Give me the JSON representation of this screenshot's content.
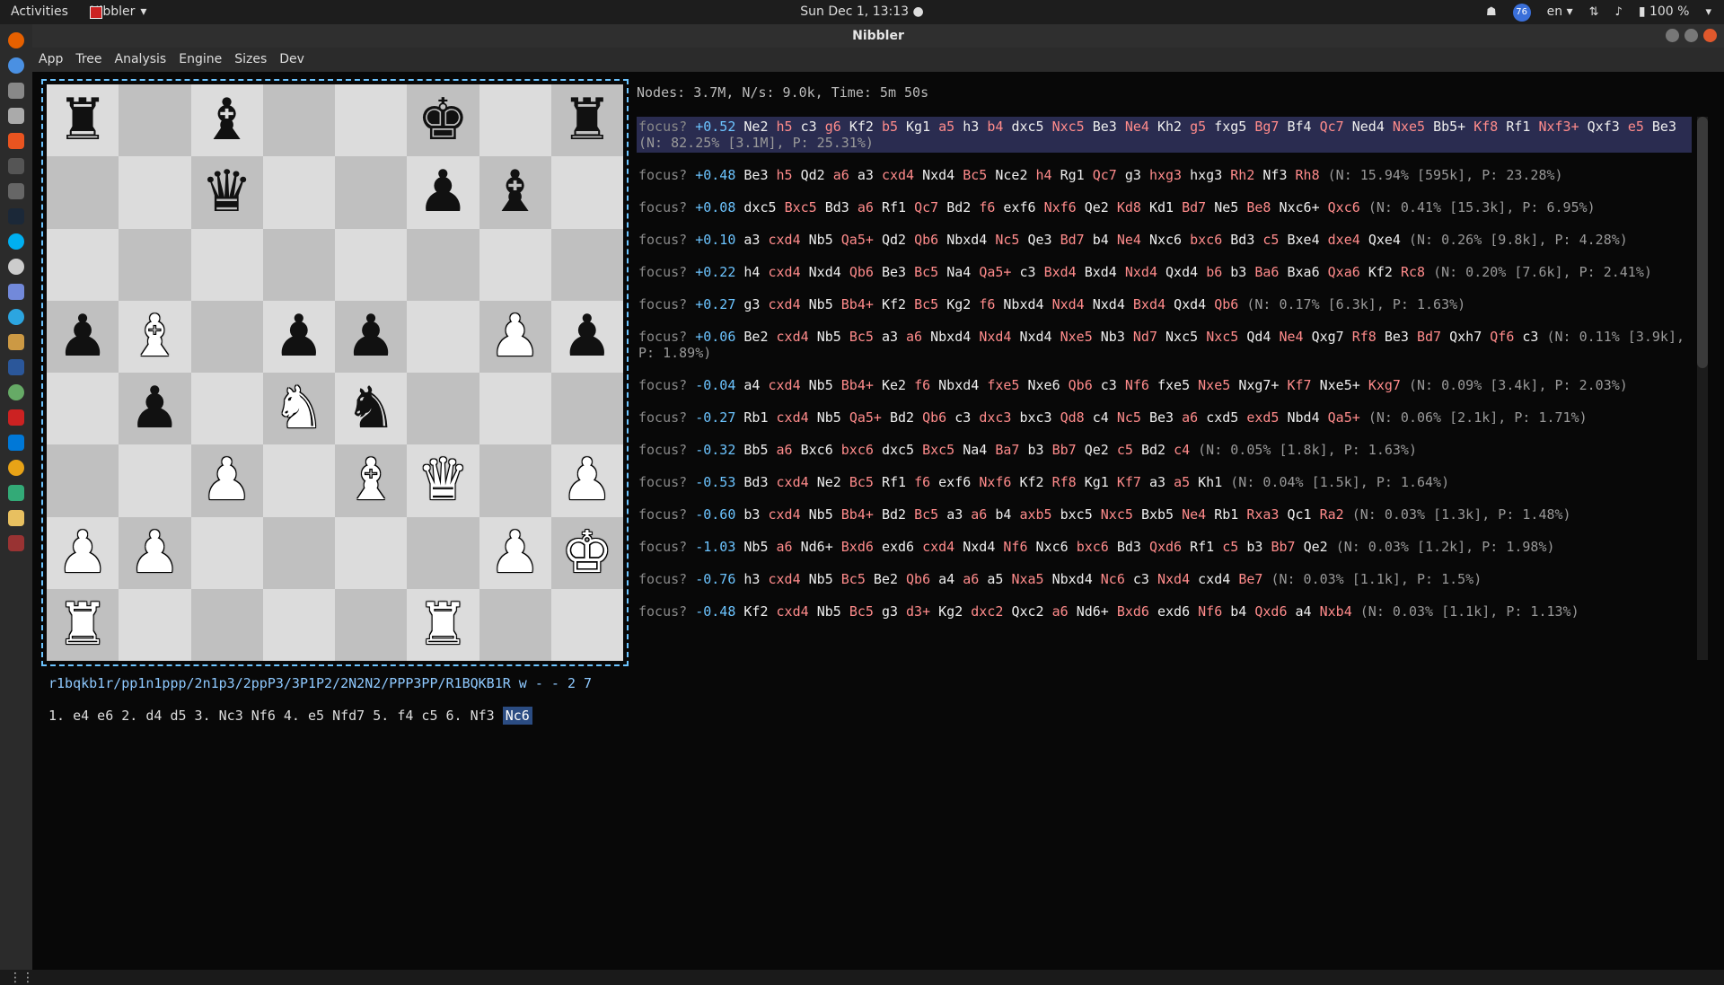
{
  "topbar": {
    "activities": "Activities",
    "app": "Nibbler",
    "clock": "Sun Dec  1, 13:13",
    "badge": "76",
    "lang": "en",
    "battery": "100 %"
  },
  "window": {
    "title": "Nibbler"
  },
  "menu": [
    "App",
    "Tree",
    "Analysis",
    "Engine",
    "Sizes",
    "Dev"
  ],
  "fen": "r1bqkb1r/pp1n1ppp/2n1p3/2ppP3/3P1P2/2N2N2/PPP3PP/R1BQKB1R w - - 2 7",
  "moves": {
    "text": "1. e4 e6 2. d4 d5 3. Nc3 Nf6 4. e5 Nfd7 5. f4 c5 6. Nf3",
    "current": "Nc6"
  },
  "stats": "Nodes: 3.7M, N/s: 9.0k, Time: 5m 50s",
  "focus_word": "focus?",
  "lines": [
    {
      "score": "+0.52",
      "moves": [
        "Ne2",
        "h5",
        "c3",
        "g6",
        "Kf2",
        "b5",
        "Kg1",
        "a5",
        "h3",
        "b4",
        "dxc5",
        "Nxc5",
        "Be3",
        "Ne4",
        "Kh2",
        "g5",
        "fxg5",
        "Bg7",
        "Bf4",
        "Qc7",
        "Ned4",
        "Nxe5",
        "Bb5+",
        "Kf8",
        "Rf1",
        "Nxf3+",
        "Qxf3",
        "e5",
        "Be3"
      ],
      "stat": "(N: 82.25% [3.1M], P: 25.31%)"
    },
    {
      "score": "+0.48",
      "moves": [
        "Be3",
        "h5",
        "Qd2",
        "a6",
        "a3",
        "cxd4",
        "Nxd4",
        "Bc5",
        "Nce2",
        "h4",
        "Rg1",
        "Qc7",
        "g3",
        "hxg3",
        "hxg3",
        "Rh2",
        "Nf3",
        "Rh8"
      ],
      "stat": "(N: 15.94% [595k], P: 23.28%)"
    },
    {
      "score": "+0.08",
      "moves": [
        "dxc5",
        "Bxc5",
        "Bd3",
        "a6",
        "Rf1",
        "Qc7",
        "Bd2",
        "f6",
        "exf6",
        "Nxf6",
        "Qe2",
        "Kd8",
        "Kd1",
        "Bd7",
        "Ne5",
        "Be8",
        "Nxc6+",
        "Qxc6"
      ],
      "stat": "(N: 0.41% [15.3k], P: 6.95%)"
    },
    {
      "score": "+0.10",
      "moves": [
        "a3",
        "cxd4",
        "Nb5",
        "Qa5+",
        "Qd2",
        "Qb6",
        "Nbxd4",
        "Nc5",
        "Qe3",
        "Bd7",
        "b4",
        "Ne4",
        "Nxc6",
        "bxc6",
        "Bd3",
        "c5",
        "Bxe4",
        "dxe4",
        "Qxe4"
      ],
      "stat": "(N: 0.26% [9.8k], P: 4.28%)"
    },
    {
      "score": "+0.22",
      "moves": [
        "h4",
        "cxd4",
        "Nxd4",
        "Qb6",
        "Be3",
        "Bc5",
        "Na4",
        "Qa5+",
        "c3",
        "Bxd4",
        "Bxd4",
        "Nxd4",
        "Qxd4",
        "b6",
        "b3",
        "Ba6",
        "Bxa6",
        "Qxa6",
        "Kf2",
        "Rc8"
      ],
      "stat": "(N: 0.20% [7.6k], P: 2.41%)"
    },
    {
      "score": "+0.27",
      "moves": [
        "g3",
        "cxd4",
        "Nb5",
        "Bb4+",
        "Kf2",
        "Bc5",
        "Kg2",
        "f6",
        "Nbxd4",
        "Nxd4",
        "Nxd4",
        "Bxd4",
        "Qxd4",
        "Qb6"
      ],
      "stat": "(N: 0.17% [6.3k], P: 1.63%)"
    },
    {
      "score": "+0.06",
      "moves": [
        "Be2",
        "cxd4",
        "Nb5",
        "Bc5",
        "a3",
        "a6",
        "Nbxd4",
        "Nxd4",
        "Nxd4",
        "Nxe5",
        "Nb3",
        "Nd7",
        "Nxc5",
        "Nxc5",
        "Qd4",
        "Ne4",
        "Qxg7",
        "Rf8",
        "Be3",
        "Bd7",
        "Qxh7",
        "Qf6",
        "c3"
      ],
      "stat": "(N: 0.11% [3.9k], P: 1.89%)"
    },
    {
      "score": "-0.04",
      "moves": [
        "a4",
        "cxd4",
        "Nb5",
        "Bb4+",
        "Ke2",
        "f6",
        "Nbxd4",
        "fxe5",
        "Nxe6",
        "Qb6",
        "c3",
        "Nf6",
        "fxe5",
        "Nxe5",
        "Nxg7+",
        "Kf7",
        "Nxe5+",
        "Kxg7"
      ],
      "stat": "(N: 0.09% [3.4k], P: 2.03%)"
    },
    {
      "score": "-0.27",
      "moves": [
        "Rb1",
        "cxd4",
        "Nb5",
        "Qa5+",
        "Bd2",
        "Qb6",
        "c3",
        "dxc3",
        "bxc3",
        "Qd8",
        "c4",
        "Nc5",
        "Be3",
        "a6",
        "cxd5",
        "exd5",
        "Nbd4",
        "Qa5+"
      ],
      "stat": "(N: 0.06% [2.1k], P: 1.71%)"
    },
    {
      "score": "-0.32",
      "moves": [
        "Bb5",
        "a6",
        "Bxc6",
        "bxc6",
        "dxc5",
        "Bxc5",
        "Na4",
        "Ba7",
        "b3",
        "Bb7",
        "Qe2",
        "c5",
        "Bd2",
        "c4"
      ],
      "stat": "(N: 0.05% [1.8k], P: 1.63%)"
    },
    {
      "score": "-0.53",
      "moves": [
        "Bd3",
        "cxd4",
        "Ne2",
        "Bc5",
        "Rf1",
        "f6",
        "exf6",
        "Nxf6",
        "Kf2",
        "Rf8",
        "Kg1",
        "Kf7",
        "a3",
        "a5",
        "Kh1"
      ],
      "stat": "(N: 0.04% [1.5k], P: 1.64%)"
    },
    {
      "score": "-0.60",
      "moves": [
        "b3",
        "cxd4",
        "Nb5",
        "Bb4+",
        "Bd2",
        "Bc5",
        "a3",
        "a6",
        "b4",
        "axb5",
        "bxc5",
        "Nxc5",
        "Bxb5",
        "Ne4",
        "Rb1",
        "Rxa3",
        "Qc1",
        "Ra2"
      ],
      "stat": "(N: 0.03% [1.3k], P: 1.48%)"
    },
    {
      "score": "-1.03",
      "moves": [
        "Nb5",
        "a6",
        "Nd6+",
        "Bxd6",
        "exd6",
        "cxd4",
        "Nxd4",
        "Nf6",
        "Nxc6",
        "bxc6",
        "Bd3",
        "Qxd6",
        "Rf1",
        "c5",
        "b3",
        "Bb7",
        "Qe2"
      ],
      "stat": "(N: 0.03% [1.2k], P: 1.98%)"
    },
    {
      "score": "-0.76",
      "moves": [
        "h3",
        "cxd4",
        "Nb5",
        "Bc5",
        "Be2",
        "Qb6",
        "a4",
        "a6",
        "a5",
        "Nxa5",
        "Nbxd4",
        "Nc6",
        "c3",
        "Nxd4",
        "cxd4",
        "Be7"
      ],
      "stat": "(N: 0.03% [1.1k], P: 1.5%)"
    },
    {
      "score": "-0.48",
      "moves": [
        "Kf2",
        "cxd4",
        "Nb5",
        "Bc5",
        "g3",
        "d3+",
        "Kg2",
        "dxc2",
        "Qxc2",
        "a6",
        "Nd6+",
        "Bxd6",
        "exd6",
        "Nf6",
        "b4",
        "Qxd6",
        "a4",
        "Nxb4"
      ],
      "stat": "(N: 0.03% [1.1k], P: 1.13%)"
    }
  ],
  "board": [
    [
      "r",
      "",
      "b",
      "",
      "",
      "k",
      "",
      "r"
    ],
    [
      "",
      "",
      "q",
      "",
      "",
      "p",
      "b",
      ""
    ],
    [
      "",
      "",
      "",
      "",
      "",
      "",
      "",
      ""
    ],
    [
      "p",
      "B",
      "",
      "p",
      "p",
      "",
      "P",
      "p"
    ],
    [
      "",
      "p",
      "",
      "N",
      "n",
      "",
      "",
      ""
    ],
    [
      "",
      "",
      "P",
      "",
      "B",
      "Q",
      "",
      "P"
    ],
    [
      "P",
      "P",
      "",
      "",
      "",
      "",
      "P",
      "K"
    ],
    [
      "R",
      "",
      "",
      "",
      "",
      "R",
      "",
      ""
    ]
  ]
}
